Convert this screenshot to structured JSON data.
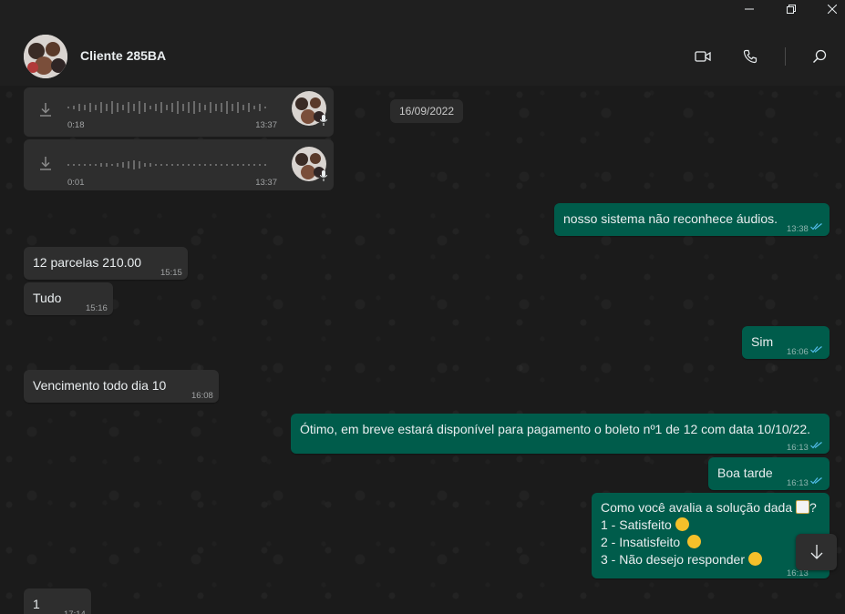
{
  "window": {
    "minimize_icon": "minimize-icon",
    "restore_icon": "restore-icon",
    "close_icon": "close-icon"
  },
  "header": {
    "contact_name": "Cliente 285BA",
    "icons": [
      "video-call-icon",
      "voice-call-icon",
      "search-icon"
    ]
  },
  "chat": {
    "date_separator": "16/09/2022",
    "audio_messages": [
      {
        "duration": "0:18",
        "time": "13:37"
      },
      {
        "duration": "0:01",
        "time": "13:37"
      }
    ],
    "messages": [
      {
        "direction": "out",
        "text": "nosso sistema não reconhece áudios.",
        "time": "13:38"
      },
      {
        "direction": "in",
        "text": "12 parcelas 210.00",
        "time": "15:15"
      },
      {
        "direction": "in",
        "text": "Tudo",
        "time": "15:16"
      },
      {
        "direction": "out",
        "text": "Sim",
        "time": "16:06"
      },
      {
        "direction": "in",
        "text": "Vencimento todo dia 10",
        "time": "16:08"
      },
      {
        "direction": "out",
        "text": "Ótimo, em breve estará disponível para pagamento o boleto nº1 de 12 com data 10/10/22.",
        "time": "16:13"
      },
      {
        "direction": "out",
        "text": "Boa tarde",
        "time": "16:13"
      },
      {
        "direction": "in",
        "text": "1",
        "time": "17:14"
      }
    ],
    "survey": {
      "line1": "Como você avalia a solução dada",
      "line1_suffix": "?",
      "line2": "1 - Satisfeito",
      "line3": "2 - Insatisfeito",
      "line4": "3 - Não desejo responder",
      "time": "16:13"
    }
  },
  "colors": {
    "incoming_bubble": "#2e2e2e",
    "outgoing_bubble": "#005c4b",
    "read_ticks": "#53bdeb"
  }
}
